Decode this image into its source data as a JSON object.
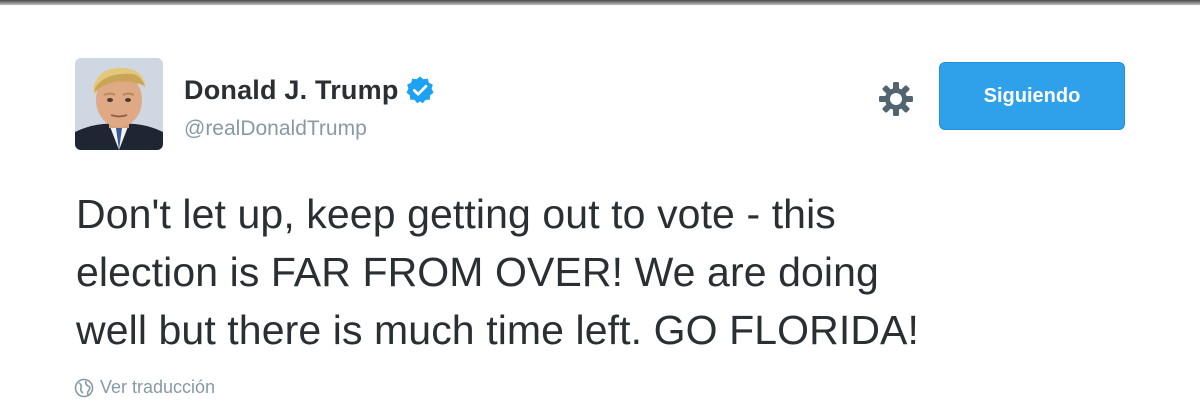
{
  "user": {
    "display_name": "Donald J. Trump",
    "handle": "@realDonaldTrump",
    "verified": true,
    "avatar_icon": "profile-photo"
  },
  "actions": {
    "settings_icon": "gear-icon",
    "follow_label": "Siguiendo"
  },
  "tweet": {
    "lines": [
      "Don't let up, keep getting out to vote - this",
      "election is FAR FROM OVER! We are doing",
      "well but there is much time left. GO FLORIDA!"
    ]
  },
  "translate": {
    "icon": "globe-icon",
    "label": "Ver traducción"
  },
  "colors": {
    "accent": "#2fa1ea",
    "verified": "#1da1f2",
    "text_primary": "#292f33",
    "text_secondary": "#8899a6"
  }
}
